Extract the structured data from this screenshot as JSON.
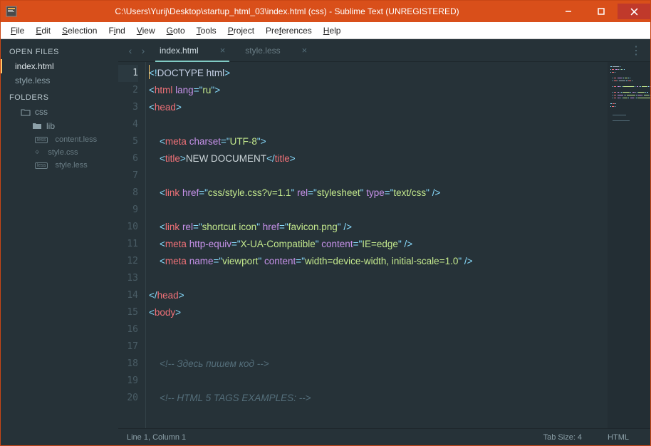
{
  "title": "C:\\Users\\Yurij\\Desktop\\startup_html_03\\index.html (css) - Sublime Text (UNREGISTERED)",
  "menu": [
    {
      "label": "File",
      "u": 0
    },
    {
      "label": "Edit",
      "u": 0
    },
    {
      "label": "Selection",
      "u": 0
    },
    {
      "label": "Find",
      "u": 1
    },
    {
      "label": "View",
      "u": 0
    },
    {
      "label": "Goto",
      "u": 0
    },
    {
      "label": "Tools",
      "u": 0
    },
    {
      "label": "Project",
      "u": 0
    },
    {
      "label": "Preferences",
      "u": 3
    },
    {
      "label": "Help",
      "u": 0
    }
  ],
  "sidebar": {
    "open_files_label": "OPEN FILES",
    "folders_label": "FOLDERS",
    "open_files": [
      {
        "label": "index.html",
        "active": true
      },
      {
        "label": "style.less",
        "active": false
      }
    ],
    "folder_root": "css",
    "folder_children": [
      {
        "label": "lib",
        "type": "folder"
      },
      {
        "label": "content.less",
        "type": "less"
      },
      {
        "label": "style.css",
        "type": "css"
      },
      {
        "label": "style.less",
        "type": "less"
      }
    ]
  },
  "tabs": [
    {
      "label": "index.html",
      "active": true
    },
    {
      "label": "style.less",
      "active": false
    }
  ],
  "statusbar": {
    "position": "Line 1, Column 1",
    "tab_size": "Tab Size: 4",
    "syntax": "HTML"
  },
  "code": [
    [
      [
        "punct",
        "<!"
      ],
      [
        "doctype",
        "DOCTYPE html"
      ],
      [
        "punct",
        ">"
      ]
    ],
    [
      [
        "punct",
        "<"
      ],
      [
        "tag",
        "html"
      ],
      [
        "txt",
        " "
      ],
      [
        "attr",
        "lang"
      ],
      [
        "eq",
        "="
      ],
      [
        "punct",
        "\""
      ],
      [
        "str",
        "ru"
      ],
      [
        "punct",
        "\""
      ],
      [
        "punct",
        ">"
      ]
    ],
    [
      [
        "punct",
        "<"
      ],
      [
        "tag",
        "head"
      ],
      [
        "punct",
        ">"
      ]
    ],
    [],
    [
      [
        "txt",
        "    "
      ],
      [
        "punct",
        "<"
      ],
      [
        "tag",
        "meta"
      ],
      [
        "txt",
        " "
      ],
      [
        "attr",
        "charset"
      ],
      [
        "eq",
        "="
      ],
      [
        "punct",
        "\""
      ],
      [
        "str",
        "UTF-8"
      ],
      [
        "punct",
        "\""
      ],
      [
        "punct",
        ">"
      ]
    ],
    [
      [
        "txt",
        "    "
      ],
      [
        "punct",
        "<"
      ],
      [
        "tag",
        "title"
      ],
      [
        "punct",
        ">"
      ],
      [
        "txt",
        "NEW DOCUMENT"
      ],
      [
        "punct",
        "</"
      ],
      [
        "tag",
        "title"
      ],
      [
        "punct",
        ">"
      ]
    ],
    [],
    [
      [
        "txt",
        "    "
      ],
      [
        "punct",
        "<"
      ],
      [
        "tag",
        "link"
      ],
      [
        "txt",
        " "
      ],
      [
        "attr",
        "href"
      ],
      [
        "eq",
        "="
      ],
      [
        "punct",
        "\""
      ],
      [
        "str",
        "css/style.css?v=1.1"
      ],
      [
        "punct",
        "\""
      ],
      [
        "txt",
        " "
      ],
      [
        "attr",
        "rel"
      ],
      [
        "eq",
        "="
      ],
      [
        "punct",
        "\""
      ],
      [
        "str",
        "stylesheet"
      ],
      [
        "punct",
        "\""
      ],
      [
        "txt",
        " "
      ],
      [
        "attr",
        "type"
      ],
      [
        "eq",
        "="
      ],
      [
        "punct",
        "\""
      ],
      [
        "str",
        "text/css"
      ],
      [
        "punct",
        "\""
      ],
      [
        "txt",
        " "
      ],
      [
        "punct",
        "/>"
      ]
    ],
    [],
    [
      [
        "txt",
        "    "
      ],
      [
        "punct",
        "<"
      ],
      [
        "tag",
        "link"
      ],
      [
        "txt",
        " "
      ],
      [
        "attr",
        "rel"
      ],
      [
        "eq",
        "="
      ],
      [
        "punct",
        "\""
      ],
      [
        "str",
        "shortcut icon"
      ],
      [
        "punct",
        "\""
      ],
      [
        "txt",
        " "
      ],
      [
        "attr",
        "href"
      ],
      [
        "eq",
        "="
      ],
      [
        "punct",
        "\""
      ],
      [
        "str",
        "favicon.png"
      ],
      [
        "punct",
        "\""
      ],
      [
        "txt",
        " "
      ],
      [
        "punct",
        "/>"
      ]
    ],
    [
      [
        "txt",
        "    "
      ],
      [
        "punct",
        "<"
      ],
      [
        "tag",
        "meta"
      ],
      [
        "txt",
        " "
      ],
      [
        "attr",
        "http-equiv"
      ],
      [
        "eq",
        "="
      ],
      [
        "punct",
        "\""
      ],
      [
        "str",
        "X-UA-Compatible"
      ],
      [
        "punct",
        "\""
      ],
      [
        "txt",
        " "
      ],
      [
        "attr",
        "content"
      ],
      [
        "eq",
        "="
      ],
      [
        "punct",
        "\""
      ],
      [
        "str",
        "IE=edge"
      ],
      [
        "punct",
        "\""
      ],
      [
        "txt",
        " "
      ],
      [
        "punct",
        "/>"
      ]
    ],
    [
      [
        "txt",
        "    "
      ],
      [
        "punct",
        "<"
      ],
      [
        "tag",
        "meta"
      ],
      [
        "txt",
        " "
      ],
      [
        "attr",
        "name"
      ],
      [
        "eq",
        "="
      ],
      [
        "punct",
        "\""
      ],
      [
        "str",
        "viewport"
      ],
      [
        "punct",
        "\""
      ],
      [
        "txt",
        " "
      ],
      [
        "attr",
        "content"
      ],
      [
        "eq",
        "="
      ],
      [
        "punct",
        "\""
      ],
      [
        "str",
        "width=device-width, initial-scale=1.0"
      ],
      [
        "punct",
        "\""
      ],
      [
        "txt",
        " "
      ],
      [
        "punct",
        "/>"
      ]
    ],
    [],
    [
      [
        "punct",
        "</"
      ],
      [
        "tag",
        "head"
      ],
      [
        "punct",
        ">"
      ]
    ],
    [
      [
        "punct",
        "<"
      ],
      [
        "tag",
        "body"
      ],
      [
        "punct",
        ">"
      ]
    ],
    [],
    [],
    [
      [
        "txt",
        "    "
      ],
      [
        "comment",
        "<!-- Здесь пишем код -->"
      ]
    ],
    [],
    [
      [
        "txt",
        "    "
      ],
      [
        "comment",
        "<!-- HTML 5 TAGS EXAMPLES: -->"
      ]
    ]
  ],
  "minimap_colors": {
    "tag": "#f07178",
    "attr": "#c792ea",
    "str": "#c3e88d",
    "punct": "#89ddff",
    "comment": "#546e7a",
    "txt": "#9fb0b8"
  }
}
